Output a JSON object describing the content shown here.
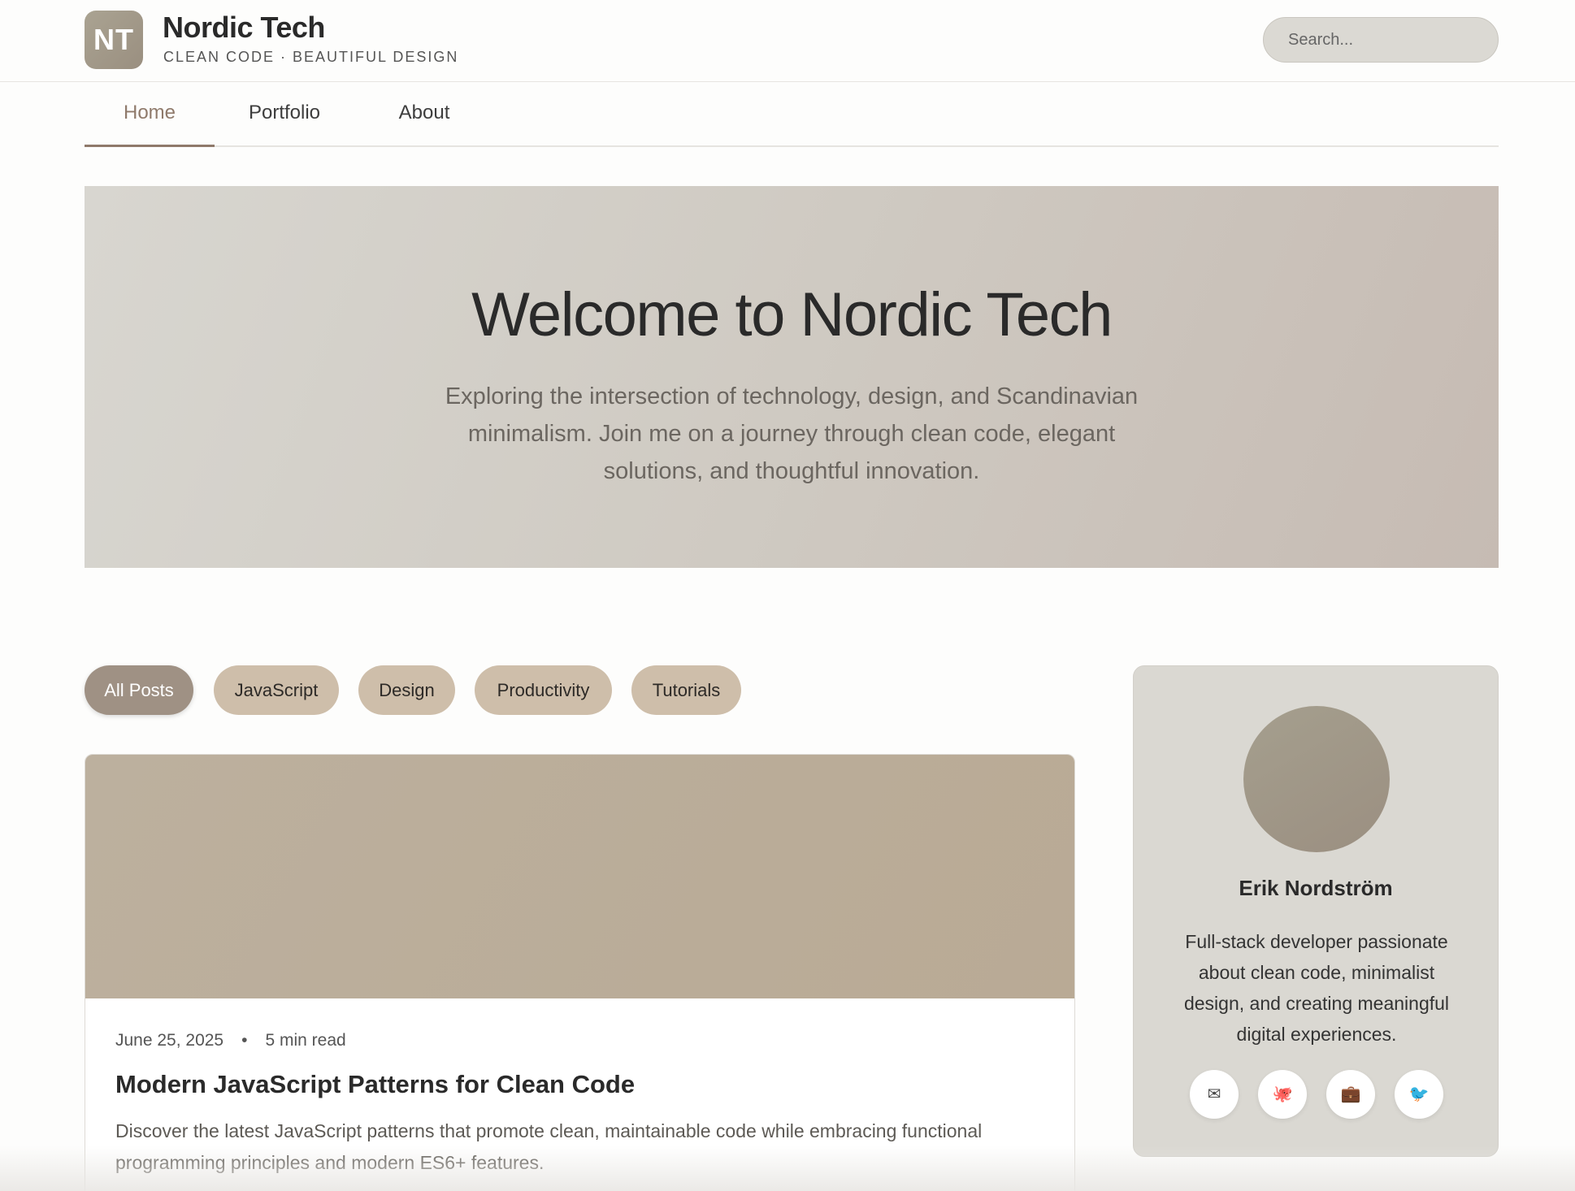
{
  "brand": {
    "logo_text": "NT",
    "name": "Nordic Tech",
    "tagline": "CLEAN CODE · BEAUTIFUL DESIGN"
  },
  "search": {
    "placeholder": "Search..."
  },
  "nav": {
    "items": [
      {
        "label": "Home",
        "active": true
      },
      {
        "label": "Portfolio",
        "active": false
      },
      {
        "label": "About",
        "active": false
      }
    ]
  },
  "hero": {
    "title": "Welcome to Nordic Tech",
    "text": "Exploring the intersection of technology, design, and Scandinavian minimalism. Join me on a journey through clean code, elegant solutions, and thoughtful innovation."
  },
  "filters": [
    {
      "label": "All Posts",
      "active": true
    },
    {
      "label": "JavaScript",
      "active": false
    },
    {
      "label": "Design",
      "active": false
    },
    {
      "label": "Productivity",
      "active": false
    },
    {
      "label": "Tutorials",
      "active": false
    }
  ],
  "post": {
    "date": "June 25, 2025",
    "separator": "•",
    "read_time": "5 min read",
    "title": "Modern JavaScript Patterns for Clean Code",
    "excerpt": "Discover the latest JavaScript patterns that promote clean, maintainable code while embracing functional programming principles and modern ES6+ features."
  },
  "profile": {
    "name": "Erik Nordström",
    "bio": "Full-stack developer passionate about clean code, minimalist design, and creating meaningful digital experiences.",
    "social": [
      {
        "icon": "email-icon",
        "glyph": "✉"
      },
      {
        "icon": "github-octopus-icon",
        "glyph": "🐙"
      },
      {
        "icon": "briefcase-icon",
        "glyph": "💼"
      },
      {
        "icon": "bird-icon",
        "glyph": "🐦"
      }
    ]
  },
  "colors": {
    "accent": "#8f7a6b",
    "chip": "#cebeaa",
    "chip_active": "#9f9184",
    "hero_bg": "#d8d6d0",
    "sidebar_bg": "#dad8d2"
  }
}
